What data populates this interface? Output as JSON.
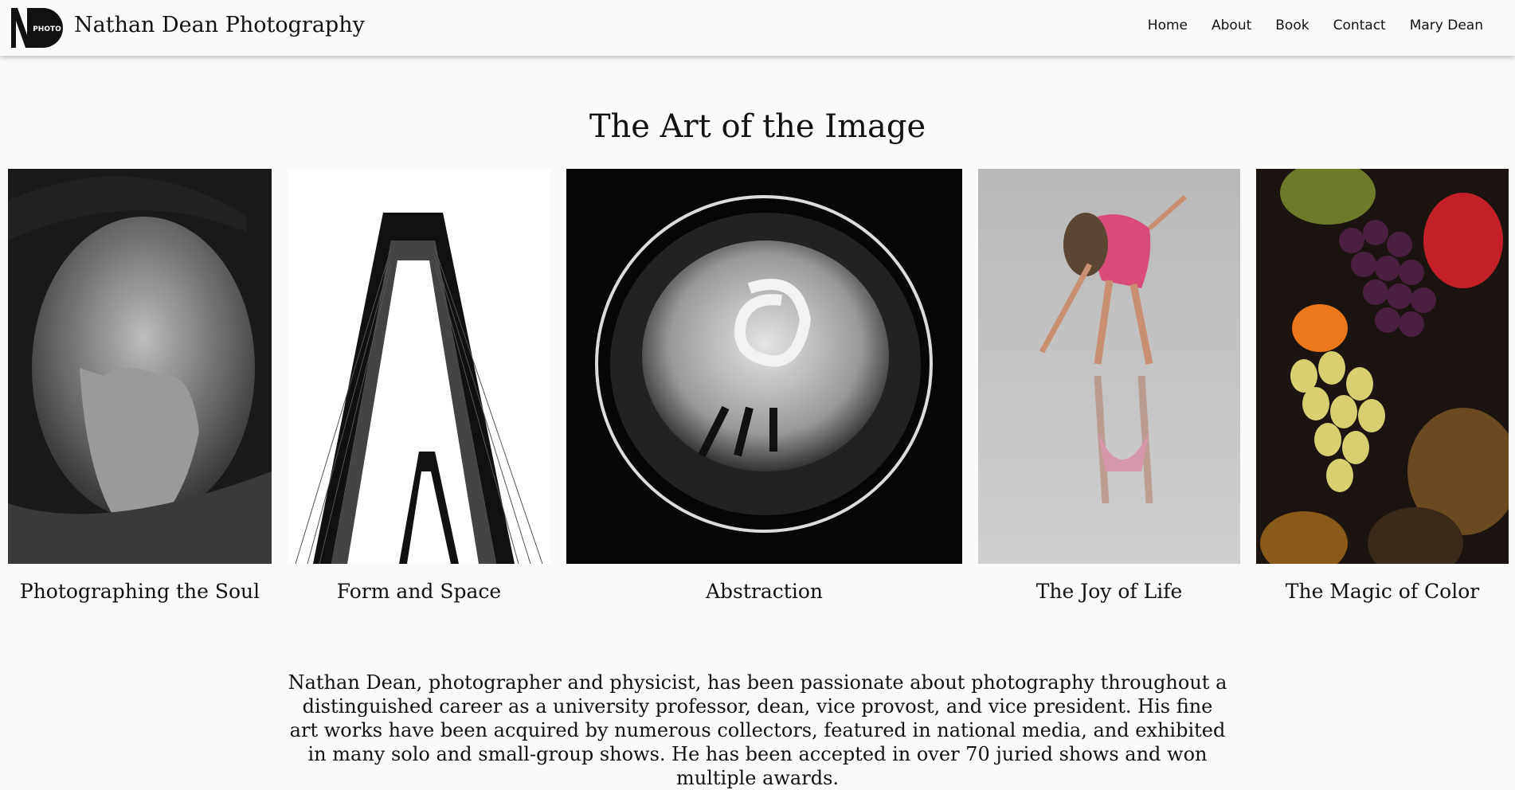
{
  "header": {
    "logo_text": "PHOTO",
    "site_title": "Nathan Dean Photography",
    "nav": [
      {
        "label": "Home"
      },
      {
        "label": "About"
      },
      {
        "label": "Book"
      },
      {
        "label": "Contact"
      },
      {
        "label": "Mary Dean"
      }
    ]
  },
  "main": {
    "title": "The Art of the Image",
    "gallery": [
      {
        "caption": "Photographing the Soul",
        "subject": "portrait-photo"
      },
      {
        "caption": "Form and Space",
        "subject": "bridge-photo"
      },
      {
        "caption": "Abstraction",
        "subject": "abstract-glass-photo"
      },
      {
        "caption": "The Joy of Life",
        "subject": "beach-girl-photo"
      },
      {
        "caption": "The Magic of Color",
        "subject": "fruit-photo"
      }
    ],
    "bio": "Nathan Dean, photographer and physicist, has been passionate about photography throughout a distinguished career as a university professor, dean, vice provost, and vice president. His fine art works have been acquired by numerous collectors, featured in national media, and exhibited in many solo and small-group shows. He has been accepted in over 70 juried shows and won multiple awards."
  },
  "colors": {
    "background": "#fafafa",
    "text": "#111111",
    "accent_pink": "#d94c7a"
  }
}
